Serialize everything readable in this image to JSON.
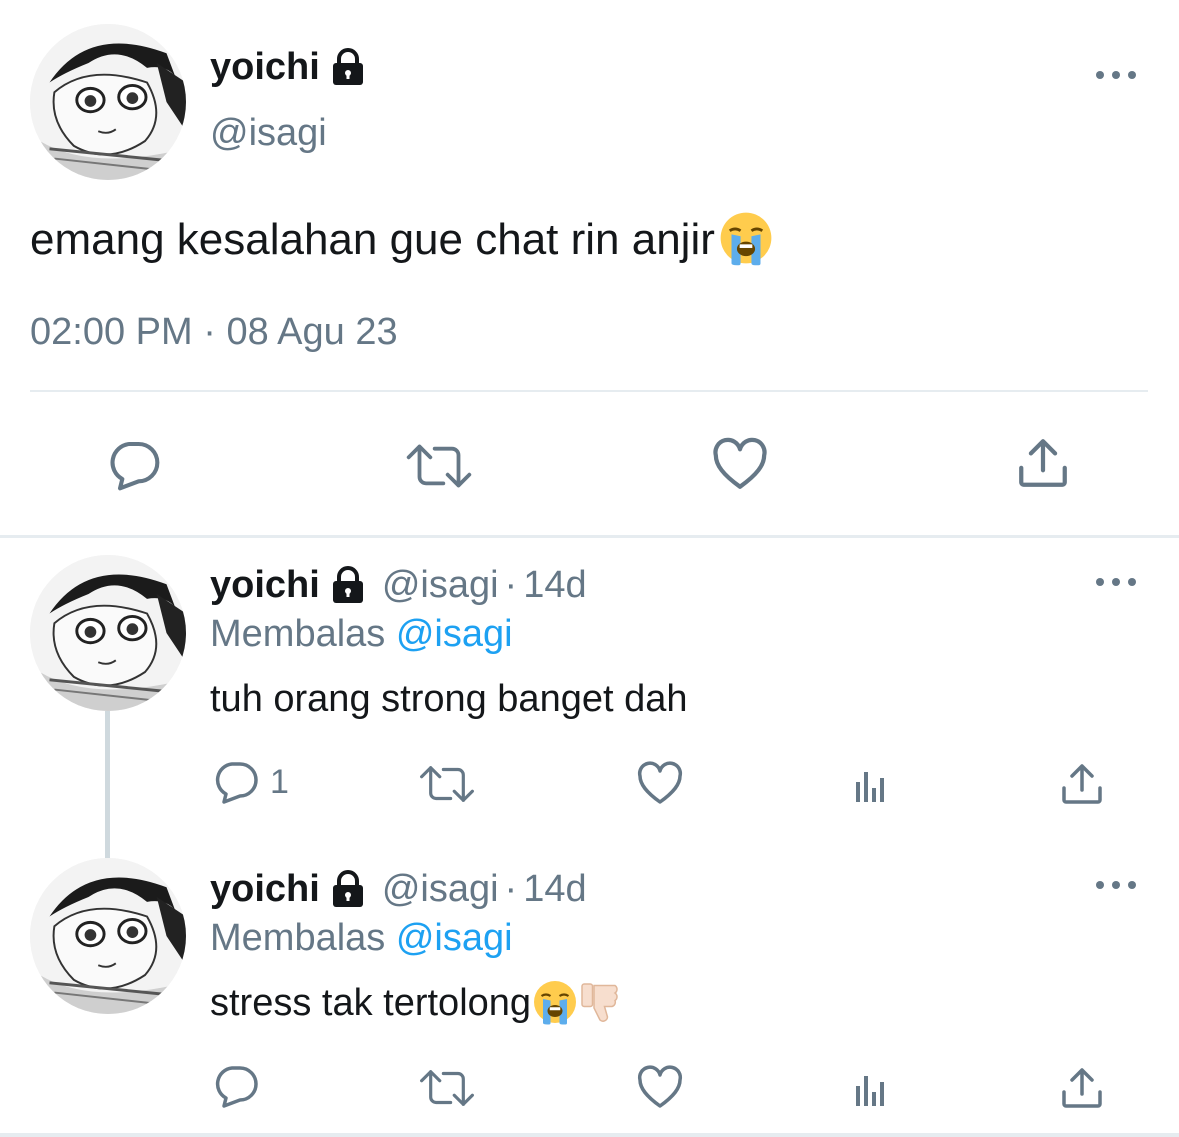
{
  "main_tweet": {
    "display_name": "yoichi",
    "handle": "@isagi",
    "text": "emang kesalahan gue chat rin anjir",
    "emoji": "loudly-crying-face",
    "time": "02:00 PM",
    "separator": "·",
    "date": "08 Agu 23",
    "actions": [
      "reply-icon",
      "retweet-icon",
      "like-icon",
      "share-icon"
    ]
  },
  "replies": [
    {
      "display_name": "yoichi",
      "handle": "@isagi",
      "separator": "·",
      "time": "14d",
      "replying_label": "Membalas",
      "replying_to": "@isagi",
      "text": "tuh orang strong banget dah",
      "reply_count": "1"
    },
    {
      "display_name": "yoichi",
      "handle": "@isagi",
      "separator": "·",
      "time": "14d",
      "replying_label": "Membalas",
      "replying_to": "@isagi",
      "text": "stress tak tertolong",
      "emojis": [
        "loudly-crying-face",
        "thumbs-down"
      ],
      "reply_count": ""
    }
  ],
  "colors": {
    "text": "#14171a",
    "secondary": "#657786",
    "link": "#1da1f2",
    "divider": "#e6ecf0"
  }
}
